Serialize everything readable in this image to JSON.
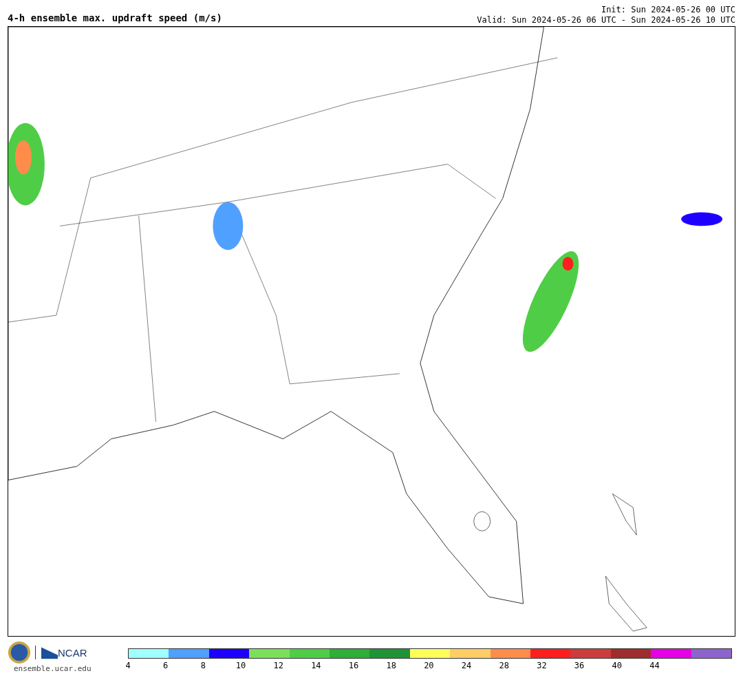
{
  "title": "4-h ensemble max. updraft speed (m/s)",
  "init": "Init: Sun 2024-05-26 00 UTC",
  "valid": "Valid: Sun 2024-05-26 06 UTC - Sun 2024-05-26 10 UTC",
  "footer": {
    "logo_text": "NCAR",
    "site": "ensemble.ucar.edu"
  },
  "colorbar": {
    "segments": [
      {
        "color": "#a0ffff"
      },
      {
        "color": "#50a0ff"
      },
      {
        "color": "#1e00ff"
      },
      {
        "color": "#7ae05a"
      },
      {
        "color": "#50cd46"
      },
      {
        "color": "#2daf38"
      },
      {
        "color": "#1e9436"
      },
      {
        "color": "#ffff5a"
      },
      {
        "color": "#ffcd64"
      },
      {
        "color": "#ff8c4b"
      },
      {
        "color": "#ff1e1e"
      },
      {
        "color": "#cd3c3c"
      },
      {
        "color": "#a02d2d"
      },
      {
        "color": "#e600e6"
      },
      {
        "color": "#8c64cd"
      }
    ],
    "ticks": [
      "4",
      "6",
      "8",
      "10",
      "12",
      "14",
      "16",
      "18",
      "20",
      "24",
      "28",
      "32",
      "36",
      "40",
      "44"
    ]
  }
}
